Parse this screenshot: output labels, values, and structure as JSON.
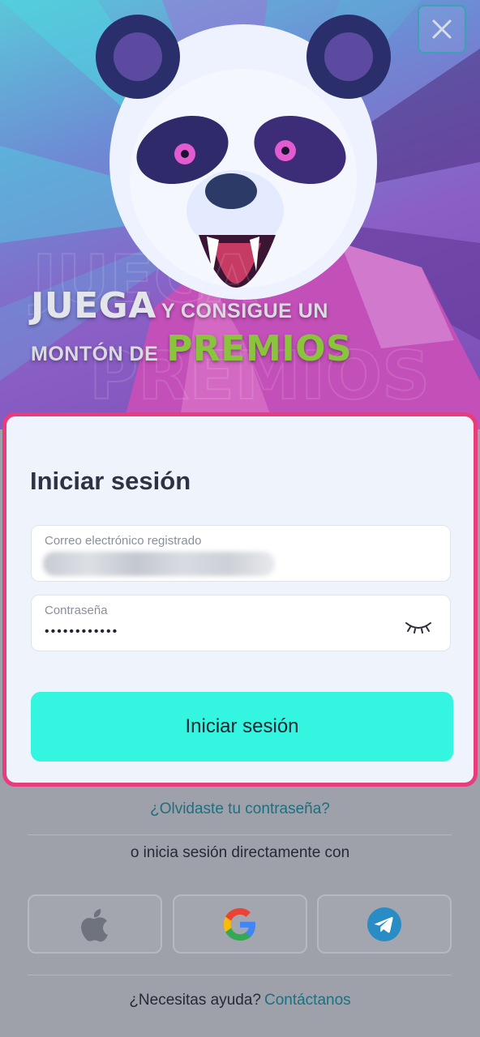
{
  "header": {
    "close_icon": "close-icon",
    "headline_word1": "JUEGA",
    "headline_rest1": "Y CONSIGUE UN",
    "headline_rest2": "MONTÓN DE",
    "headline_word2": "PREMIOS",
    "colors": {
      "accent_green": "#8ac43c"
    }
  },
  "login": {
    "title": "Iniciar sesión",
    "email": {
      "label": "Correo electrónico registrado",
      "value": ""
    },
    "password": {
      "label": "Contraseña",
      "value": "••••••••••••",
      "toggle_icon": "eye-closed-icon"
    },
    "submit_label": "Iniciar sesión",
    "colors": {
      "border": "#e73d7a",
      "button": "#33f5e0"
    }
  },
  "footer": {
    "forgot_label": "¿Olvidaste tu contraseña?",
    "alt_login_text": "o inicia sesión directamente con",
    "social": [
      "apple-icon",
      "google-icon",
      "telegram-icon"
    ],
    "help_text": "¿Necesitas ayuda?",
    "help_link": "Contáctanos"
  }
}
